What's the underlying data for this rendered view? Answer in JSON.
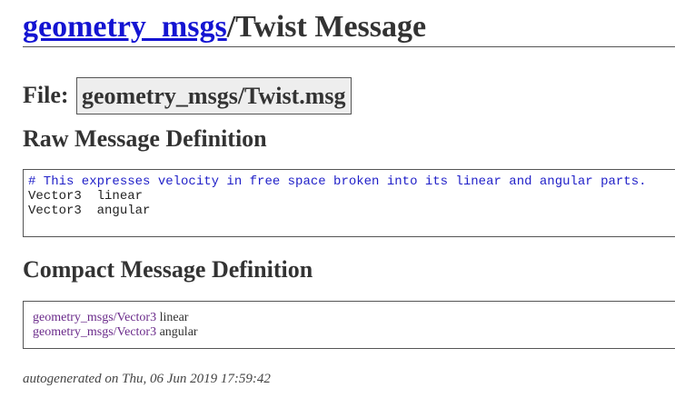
{
  "header": {
    "package_link": "geometry_msgs",
    "title_suffix": "/Twist Message"
  },
  "file": {
    "label": "File:",
    "path": "geometry_msgs/Twist.msg"
  },
  "raw_definition": {
    "heading": "Raw Message Definition",
    "comment": "# This expresses velocity in free space broken into its linear and angular parts.",
    "lines": [
      {
        "type": "Vector3",
        "spacer": "  ",
        "name": "linear"
      },
      {
        "type": "Vector3",
        "spacer": "  ",
        "name": "angular"
      }
    ]
  },
  "compact_definition": {
    "heading": "Compact Message Definition",
    "fields": [
      {
        "type_link": "geometry_msgs/Vector3",
        "name": "linear"
      },
      {
        "type_link": "geometry_msgs/Vector3",
        "name": "angular"
      }
    ]
  },
  "footer": {
    "text": "autogenerated on Thu, 06 Jun 2019 17:59:42"
  },
  "colors": {
    "link": "#1414d2",
    "visited_link": "#6a2a8a",
    "comment": "#2020c8",
    "code_background": "#eeeeee"
  }
}
